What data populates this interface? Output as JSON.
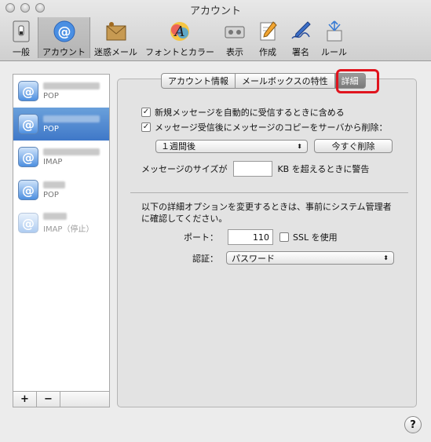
{
  "window": {
    "title": "アカウント"
  },
  "toolbar": {
    "items": [
      {
        "label": "一般"
      },
      {
        "label": "アカウント"
      },
      {
        "label": "迷惑メール"
      },
      {
        "label": "フォントとカラー"
      },
      {
        "label": "表示"
      },
      {
        "label": "作成"
      },
      {
        "label": "署名"
      },
      {
        "label": "ルール"
      }
    ]
  },
  "accounts": [
    {
      "type": "POP"
    },
    {
      "type": "POP"
    },
    {
      "type": "IMAP"
    },
    {
      "type": "POP"
    },
    {
      "type": "IMAP（停止）"
    }
  ],
  "list_footer": {
    "add": "+",
    "remove": "−"
  },
  "tabs": [
    {
      "label": "アカウント情報"
    },
    {
      "label": "メールボックスの特性"
    },
    {
      "label": "詳細"
    }
  ],
  "advanced": {
    "auto_check_label": "新規メッセージを自動的に受信するときに含める",
    "auto_check_mark": "✓",
    "remove_copy_label": "メッセージ受信後にメッセージのコピーをサーバから削除：",
    "remove_copy_mark": "✓",
    "remove_after_value": "１週間後",
    "remove_now_label": "今すぐ削除",
    "size_prefix": "メッセージのサイズが",
    "size_value": "",
    "size_suffix": "KB を超えるときに警告",
    "notice": "以下の詳細オプションを変更するときは、事前にシステム管理者に確認してください。",
    "port_label": "ポート：",
    "port_value": "110",
    "ssl_label": "SSL を使用",
    "auth_label": "認証：",
    "auth_value": "パスワード"
  },
  "help": {
    "label": "?"
  }
}
